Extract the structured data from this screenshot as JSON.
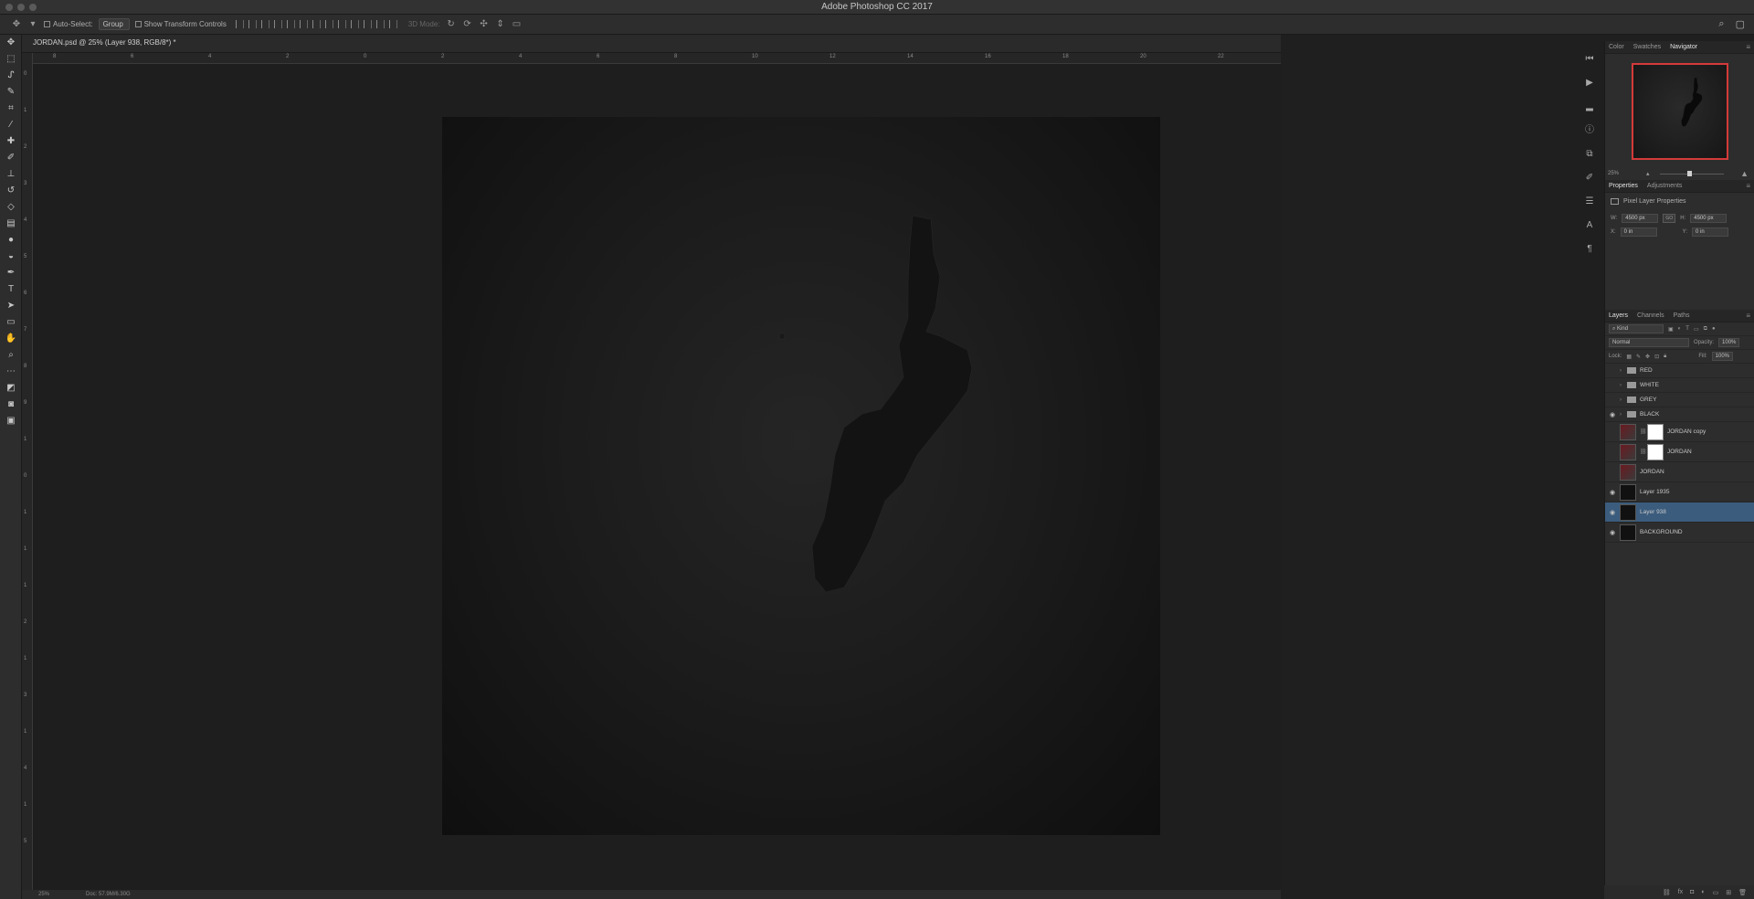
{
  "app": {
    "title": "Adobe Photoshop CC 2017"
  },
  "options": {
    "auto_select_label": "Auto-Select:",
    "auto_select_value": "Group",
    "transform_label": "Show Transform Controls",
    "mode_3d_label": "3D Mode:"
  },
  "document": {
    "tab_title": "JORDAN.psd @ 25% (Layer 938, RGB/8*) *"
  },
  "ruler": {
    "h_ticks": [
      "8",
      "6",
      "4",
      "2",
      "0",
      "2",
      "4",
      "6",
      "8",
      "10",
      "12",
      "14",
      "16",
      "18",
      "20",
      "22"
    ],
    "v_ticks": [
      "0",
      "1",
      "2",
      "3",
      "4",
      "5",
      "6",
      "7",
      "8",
      "9",
      "1",
      "0",
      "1",
      "1",
      "1",
      "2",
      "1",
      "3",
      "1",
      "4",
      "1",
      "5"
    ]
  },
  "status": {
    "zoom": "25%",
    "doc_size": "Doc: 57.9M/6.30G"
  },
  "panels": {
    "top_tabs": [
      "Color",
      "Swatches",
      "Navigator"
    ],
    "navigator_zoom": "25%",
    "prop_tabs": [
      "Properties",
      "Adjustments"
    ],
    "prop_title": "Pixel Layer Properties",
    "w_label": "W:",
    "w_value": "4500 px",
    "go_label": "GO",
    "h_label": "H:",
    "h_value": "4500 px",
    "x_label": "X:",
    "x_value": "0 in",
    "y_label": "Y:",
    "y_value": "0 in",
    "layer_tabs": [
      "Layers",
      "Channels",
      "Paths"
    ],
    "kind_label": "Kind",
    "blend_mode": "Normal",
    "opacity_label": "Opacity:",
    "opacity_value": "100%",
    "lock_label": "Lock:",
    "fill_label": "Fill:",
    "fill_value": "100%"
  },
  "layers": [
    {
      "name": "RED",
      "type": "group",
      "visible": false
    },
    {
      "name": "WHITE",
      "type": "group",
      "visible": false
    },
    {
      "name": "GREY",
      "type": "group",
      "visible": false
    },
    {
      "name": "BLACK",
      "type": "group",
      "visible": true
    },
    {
      "name": "JORDAN copy",
      "type": "masked",
      "visible": false
    },
    {
      "name": "JORDAN",
      "type": "masked",
      "visible": false
    },
    {
      "name": "JORDAN",
      "type": "image",
      "visible": false
    },
    {
      "name": "Layer 1935",
      "type": "dark",
      "visible": true
    },
    {
      "name": "Layer 938",
      "type": "dark",
      "visible": true,
      "selected": true
    },
    {
      "name": "BACKGROUND",
      "type": "black",
      "visible": true
    }
  ]
}
